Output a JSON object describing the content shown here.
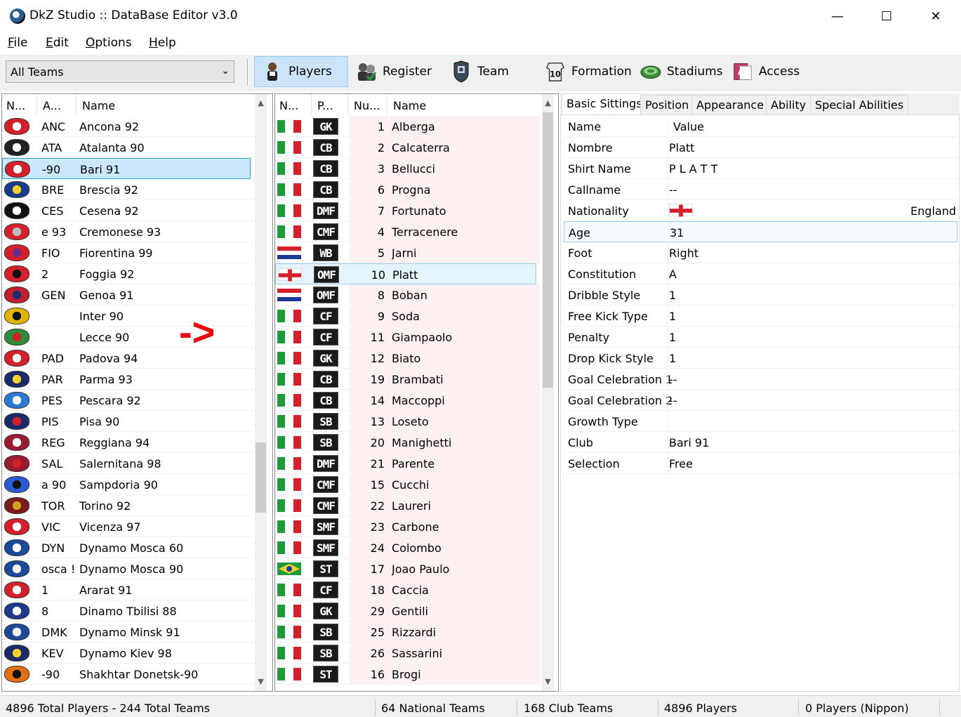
{
  "window": {
    "title": "DkZ Studio :: DataBase Editor v3.0",
    "minimize": "—",
    "maximize": "☐",
    "close": "✕"
  },
  "menu": [
    {
      "hot": "F",
      "rest": "ile"
    },
    {
      "hot": "E",
      "rest": "dit"
    },
    {
      "hot": "O",
      "rest": "ptions"
    },
    {
      "hot": "H",
      "rest": "elp"
    }
  ],
  "toolbar": {
    "team_filter": "All Teams",
    "buttons": [
      {
        "label": "Players",
        "icon": "player-icon",
        "active": true
      },
      {
        "label": "Register",
        "icon": "register-icon"
      },
      {
        "label": "Team",
        "icon": "team-icon"
      },
      {
        "label": "Formation",
        "icon": "formation-icon"
      },
      {
        "label": "Stadiums",
        "icon": "stadium-icon"
      },
      {
        "label": "Access",
        "icon": "access-icon"
      }
    ]
  },
  "teams": {
    "headers": [
      "N...",
      "A...",
      "Name"
    ],
    "rows": [
      {
        "abbr": "ANC",
        "name": "Ancona 92",
        "colors": [
          "#d4202a",
          "#ffffff"
        ]
      },
      {
        "abbr": "ATA",
        "name": "Atalanta 90",
        "colors": [
          "#222222",
          "#ffffff"
        ]
      },
      {
        "abbr": "-90",
        "name": "Bari 91",
        "colors": [
          "#d4202a",
          "#ffffff"
        ],
        "selected": true
      },
      {
        "abbr": "BRE",
        "name": "Brescia 92",
        "colors": [
          "#1b3a8a",
          "#f2d22e"
        ]
      },
      {
        "abbr": "CES",
        "name": "Cesena 92",
        "colors": [
          "#111111",
          "#ffffff"
        ]
      },
      {
        "abbr": "e 93",
        "name": "Cremonese 93",
        "colors": [
          "#d4202a",
          "#bbbbbb"
        ]
      },
      {
        "abbr": "FIO",
        "name": "Fiorentina 99",
        "colors": [
          "#d4202a",
          "#6b2b8f"
        ]
      },
      {
        "abbr": "2",
        "name": "Foggia 92",
        "colors": [
          "#d4202a",
          "#111111"
        ]
      },
      {
        "abbr": "GEN",
        "name": "Genoa 91",
        "colors": [
          "#c0202a",
          "#1b2a6a"
        ]
      },
      {
        "abbr": "",
        "name": "Inter 90",
        "colors": [
          "#e1b400",
          "#111111"
        ]
      },
      {
        "abbr": "",
        "name": "Lecce 90",
        "colors": [
          "#2e8b3a",
          "#d4202a"
        ]
      },
      {
        "abbr": "PAD",
        "name": "Padova 94",
        "colors": [
          "#d4202a",
          "#ffffff"
        ]
      },
      {
        "abbr": "PAR",
        "name": "Parma 93",
        "colors": [
          "#1b2a6a",
          "#f2d22e"
        ]
      },
      {
        "abbr": "PES",
        "name": "Pescara 92",
        "colors": [
          "#2a7ad4",
          "#ffffff"
        ]
      },
      {
        "abbr": "PIS",
        "name": "Pisa 90",
        "colors": [
          "#1b2a6a",
          "#d4202a"
        ]
      },
      {
        "abbr": "REG",
        "name": "Reggiana 94",
        "colors": [
          "#9b1b30",
          "#ffffff"
        ]
      },
      {
        "abbr": "SAL",
        "name": "Salernitana 98",
        "colors": [
          "#9b1b30",
          "#d4202a"
        ]
      },
      {
        "abbr": "a 90",
        "name": "Sampdoria 90",
        "colors": [
          "#2a5ad4",
          "#111111"
        ]
      },
      {
        "abbr": "TOR",
        "name": "Torino 92",
        "colors": [
          "#7b1b1b",
          "#d4a020"
        ]
      },
      {
        "abbr": "VIC",
        "name": "Vicenza 97",
        "colors": [
          "#d4202a",
          "#ffffff"
        ]
      },
      {
        "abbr": "DYN",
        "name": "Dynamo Mosca 60",
        "colors": [
          "#1b4a9a",
          "#ffffff"
        ]
      },
      {
        "abbr": "osca !",
        "name": "Dynamo Mosca 90",
        "colors": [
          "#1b4a9a",
          "#ffffff"
        ]
      },
      {
        "abbr": "1",
        "name": "Ararat 91",
        "colors": [
          "#d4202a",
          "#ffffff"
        ]
      },
      {
        "abbr": "8",
        "name": "Dinamo Tbilisi 88",
        "colors": [
          "#1b3a8a",
          "#ffffff"
        ]
      },
      {
        "abbr": "DMK",
        "name": "Dynamo Minsk 91",
        "colors": [
          "#1b4a9a",
          "#ffffff"
        ]
      },
      {
        "abbr": "KEV",
        "name": "Dynamo Kiev 98",
        "colors": [
          "#1b2a6a",
          "#f2d22e"
        ]
      },
      {
        "abbr": "-90",
        "name": "Shakhtar Donetsk-90",
        "colors": [
          "#e07010",
          "#111111"
        ]
      }
    ]
  },
  "players": {
    "headers": [
      "N...",
      "P...",
      "Nu...",
      "Name"
    ],
    "rows": [
      {
        "flag": "it",
        "pos": "GK",
        "num": "1",
        "name": "Alberga"
      },
      {
        "flag": "it",
        "pos": "CB",
        "num": "2",
        "name": "Calcaterra"
      },
      {
        "flag": "it",
        "pos": "CB",
        "num": "3",
        "name": "Bellucci"
      },
      {
        "flag": "it",
        "pos": "CB",
        "num": "6",
        "name": "Progna"
      },
      {
        "flag": "it",
        "pos": "DMF",
        "num": "7",
        "name": "Fortunato"
      },
      {
        "flag": "it",
        "pos": "CMF",
        "num": "4",
        "name": "Terracenere"
      },
      {
        "flag": "hr",
        "pos": "WB",
        "num": "5",
        "name": "Jarni"
      },
      {
        "flag": "en",
        "pos": "OMF",
        "num": "10",
        "name": "Platt",
        "selected": true
      },
      {
        "flag": "hr",
        "pos": "OMF",
        "num": "8",
        "name": "Boban"
      },
      {
        "flag": "it",
        "pos": "CF",
        "num": "9",
        "name": "Soda"
      },
      {
        "flag": "it",
        "pos": "CF",
        "num": "11",
        "name": "Giampaolo"
      },
      {
        "flag": "it",
        "pos": "GK",
        "num": "12",
        "name": "Biato"
      },
      {
        "flag": "it",
        "pos": "CB",
        "num": "19",
        "name": "Brambati"
      },
      {
        "flag": "it",
        "pos": "CB",
        "num": "14",
        "name": "Maccoppi"
      },
      {
        "flag": "it",
        "pos": "SB",
        "num": "13",
        "name": "Loseto"
      },
      {
        "flag": "it",
        "pos": "SB",
        "num": "20",
        "name": "Manighetti"
      },
      {
        "flag": "it",
        "pos": "DMF",
        "num": "21",
        "name": "Parente"
      },
      {
        "flag": "it",
        "pos": "CMF",
        "num": "15",
        "name": "Cucchi"
      },
      {
        "flag": "it",
        "pos": "CMF",
        "num": "22",
        "name": "Laureri"
      },
      {
        "flag": "it",
        "pos": "SMF",
        "num": "23",
        "name": "Carbone"
      },
      {
        "flag": "it",
        "pos": "SMF",
        "num": "24",
        "name": "Colombo"
      },
      {
        "flag": "br",
        "pos": "ST",
        "num": "17",
        "name": "Joao Paulo"
      },
      {
        "flag": "it",
        "pos": "CF",
        "num": "18",
        "name": "Caccia"
      },
      {
        "flag": "it",
        "pos": "GK",
        "num": "29",
        "name": "Gentili"
      },
      {
        "flag": "it",
        "pos": "SB",
        "num": "25",
        "name": "Rizzardi"
      },
      {
        "flag": "it",
        "pos": "SB",
        "num": "26",
        "name": "Sassarini"
      },
      {
        "flag": "it",
        "pos": "ST",
        "num": "16",
        "name": "Brogi"
      }
    ]
  },
  "detail": {
    "tabs": [
      "Basic Sittings",
      "Position",
      "Appearance",
      "Ability",
      "Special Abilities"
    ],
    "header": {
      "key": "Name",
      "value": "Value"
    },
    "rows": [
      {
        "key": "Nombre",
        "value": "Platt"
      },
      {
        "key": "Shirt Name",
        "value": "P L A T T"
      },
      {
        "key": "Callname",
        "value": "--"
      },
      {
        "key": "Nationality",
        "value": "",
        "extra": "England",
        "flag": "en"
      },
      {
        "key": "Age",
        "value": "31",
        "selected": true
      },
      {
        "key": "Foot",
        "value": "Right"
      },
      {
        "key": "Constitution",
        "value": "A"
      },
      {
        "key": "Dribble Style",
        "value": "1"
      },
      {
        "key": "Free Kick Type",
        "value": "1"
      },
      {
        "key": "Penalty",
        "value": "1"
      },
      {
        "key": "Drop Kick Style",
        "value": "1"
      },
      {
        "key": "Goal Celebration 1",
        "value": "--"
      },
      {
        "key": "Goal Celebration 2",
        "value": "--"
      },
      {
        "key": "Growth Type",
        "value": ""
      },
      {
        "key": "Club",
        "value": "Bari 91"
      },
      {
        "key": "Selection",
        "value": "Free"
      }
    ]
  },
  "status": {
    "totals": "4896 Total Players  -  244 Total Teams",
    "national": "64 National Teams",
    "club": "168 Club Teams",
    "players": "4896 Players",
    "nippon": "0 Players (Nippon)"
  },
  "annotation": "->",
  "colors": {
    "selection": "#cce8ff",
    "selection_border": "#26a0da",
    "active_tool": "#cce4f7",
    "annotation": "#e8000b"
  }
}
